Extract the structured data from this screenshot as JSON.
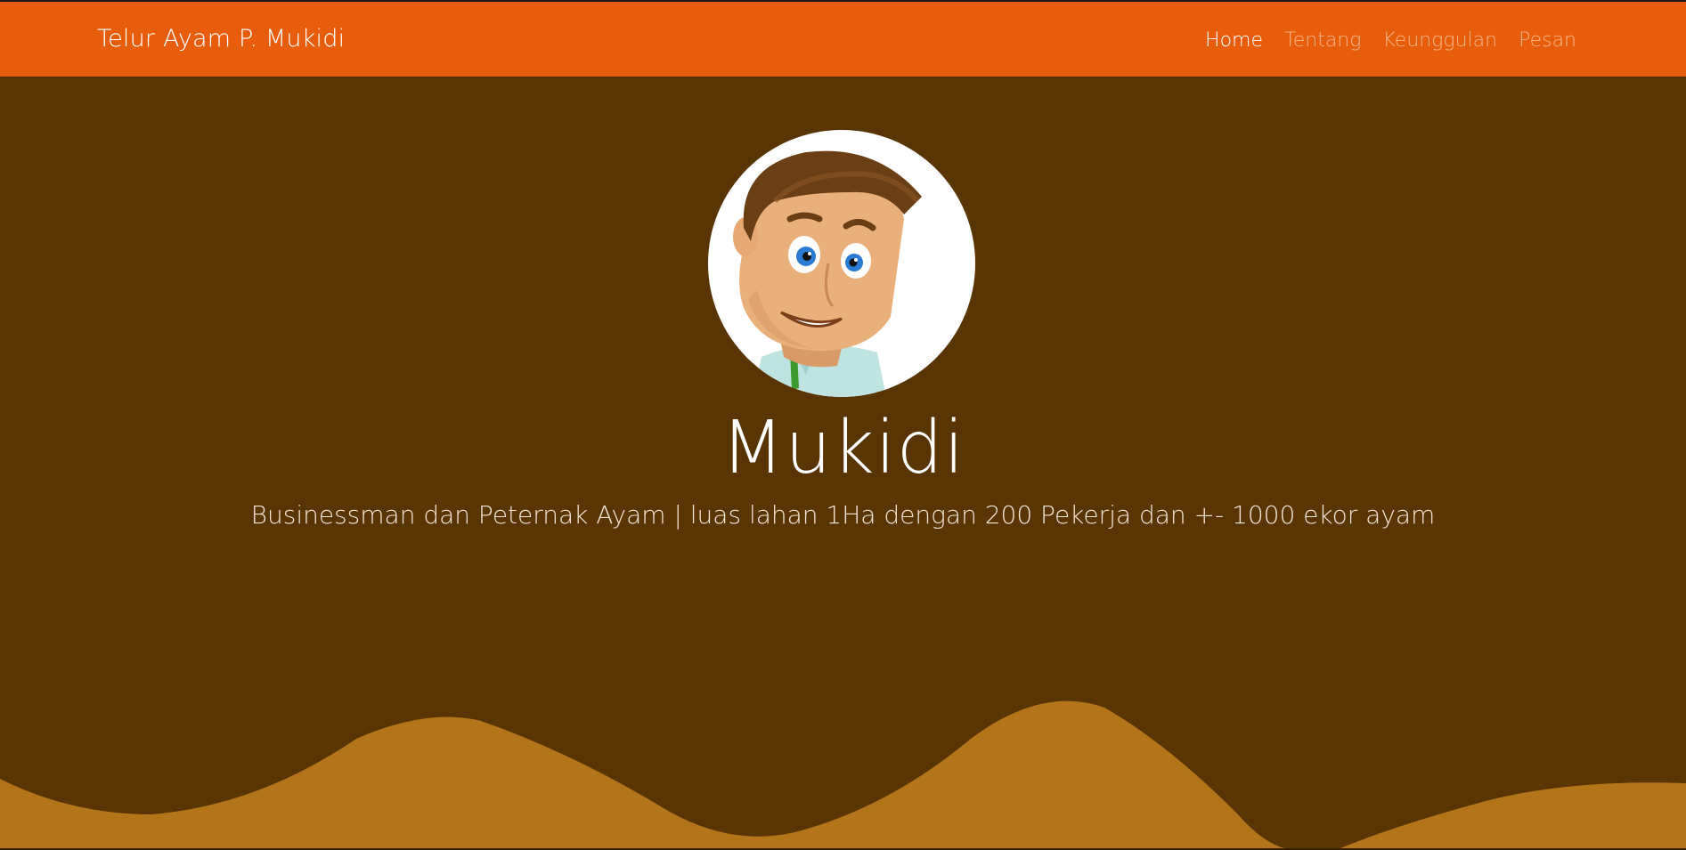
{
  "navbar": {
    "brand": "Telur Ayam P. Mukidi",
    "links": [
      {
        "label": "Home",
        "active": true
      },
      {
        "label": "Tentang",
        "active": false
      },
      {
        "label": "Keunggulan",
        "active": false
      },
      {
        "label": "Pesan",
        "active": false
      }
    ]
  },
  "hero": {
    "avatar_icon": "cartoon-man-avatar",
    "title": "Mukidi",
    "subtitle": "Businessman dan Peternak Ayam | luas lahan 1Ha dengan 200 Pekerja dan +- 1000 ekor ayam"
  },
  "colors": {
    "navbar_bg": "#e85d0b",
    "hero_bg": "#593503",
    "wave": "#b3741a",
    "nav_active": "#ffffff",
    "nav_inactive": "#f6b78a"
  }
}
